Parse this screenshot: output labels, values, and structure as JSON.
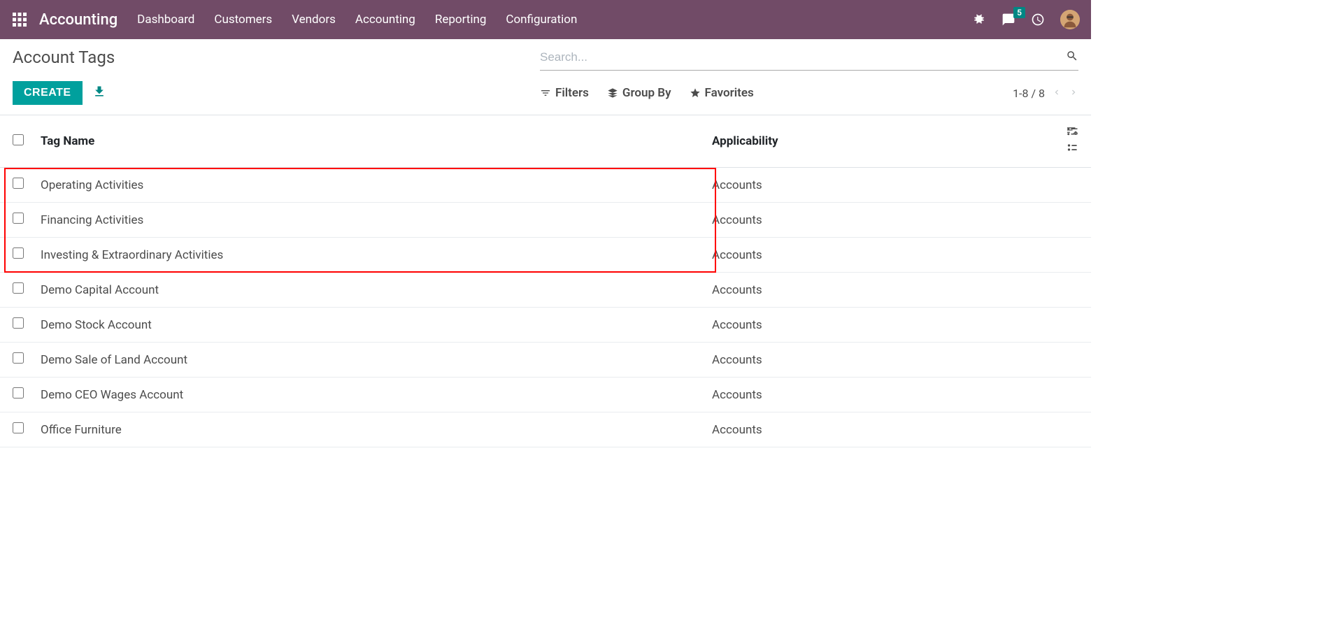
{
  "navbar": {
    "app_name": "Accounting",
    "items": [
      "Dashboard",
      "Customers",
      "Vendors",
      "Accounting",
      "Reporting",
      "Configuration"
    ],
    "messages_badge": "5"
  },
  "page": {
    "title": "Account Tags",
    "create_label": "CREATE",
    "search_placeholder": "Search...",
    "filters_label": "Filters",
    "groupby_label": "Group By",
    "favorites_label": "Favorites",
    "pager": "1-8 / 8"
  },
  "table": {
    "header_name": "Tag Name",
    "header_app": "Applicability",
    "rows": [
      {
        "name": "Operating Activities",
        "app": "Accounts"
      },
      {
        "name": "Financing Activities",
        "app": "Accounts"
      },
      {
        "name": "Investing & Extraordinary Activities",
        "app": "Accounts"
      },
      {
        "name": "Demo Capital Account",
        "app": "Accounts"
      },
      {
        "name": "Demo Stock Account",
        "app": "Accounts"
      },
      {
        "name": "Demo Sale of Land Account",
        "app": "Accounts"
      },
      {
        "name": "Demo CEO Wages Account",
        "app": "Accounts"
      },
      {
        "name": "Office Furniture",
        "app": "Accounts"
      }
    ]
  }
}
